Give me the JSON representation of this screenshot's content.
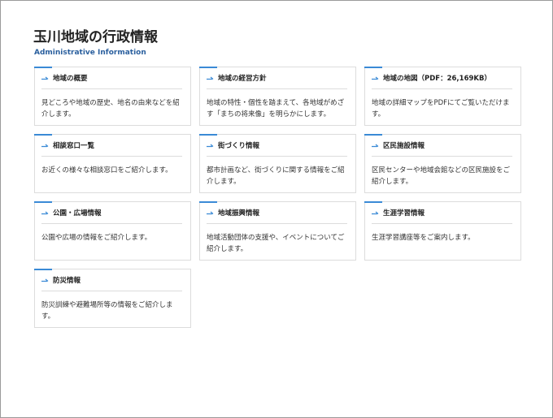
{
  "header": {
    "title": "玉川地域の行政情報",
    "subtitle": "Administrative Information"
  },
  "accent_color": "#3a8ad6",
  "cards": [
    {
      "title": "地域の概要",
      "desc": "見どころや地域の歴史、地名の由来などを紹介します。"
    },
    {
      "title": "地域の経営方針",
      "desc": "地域の特性・個性を踏まえて、各地域がめざす「まちの将来像」を明らかにします。"
    },
    {
      "title": "地域の地図（PDF：26,169KB）",
      "desc": "地域の詳細マップをPDFにてご覧いただけます。"
    },
    {
      "title": "相談窓口一覧",
      "desc": "お近くの様々な相談窓口をご紹介します。"
    },
    {
      "title": "街づくり情報",
      "desc": "都市計画など、街づくりに関する情報をご紹介します。"
    },
    {
      "title": "区民施設情報",
      "desc": "区民センターや地域会館などの区民施設をご紹介します。"
    },
    {
      "title": "公園・広場情報",
      "desc": "公園や広場の情報をご紹介します。"
    },
    {
      "title": "地域振興情報",
      "desc": "地域活動団体の支援や、イベントについてご紹介します。"
    },
    {
      "title": "生涯学習情報",
      "desc": "生涯学習講座等をご案内します。"
    },
    {
      "title": "防災情報",
      "desc": "防災訓練や避難場所等の情報をご紹介します。"
    }
  ]
}
